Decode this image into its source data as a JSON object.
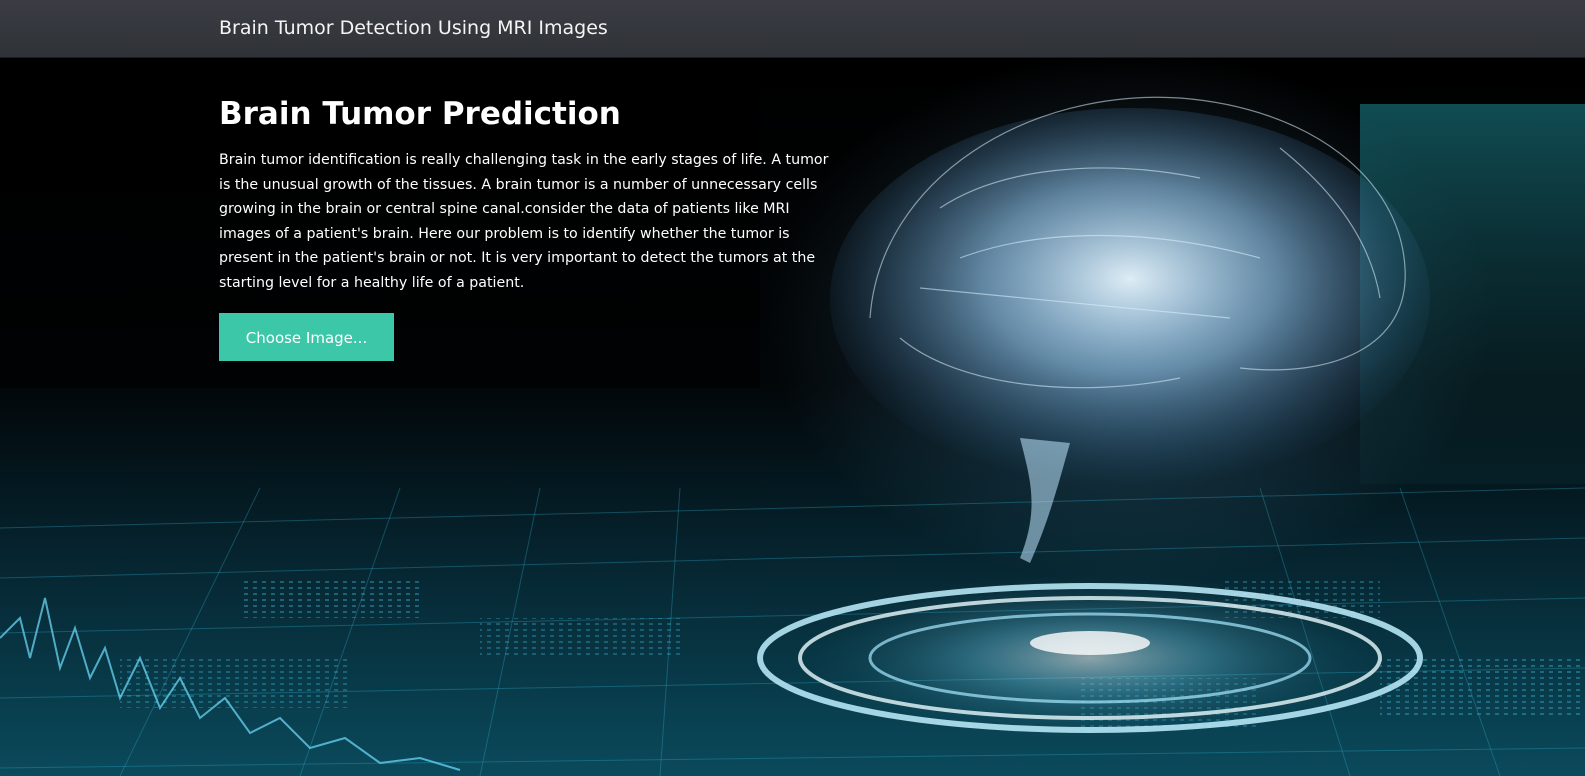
{
  "navbar": {
    "brand": "Brain Tumor Detection Using MRI Images"
  },
  "hero": {
    "title": "Brain Tumor Prediction",
    "description": "Brain tumor identification is really challenging task in the early stages of life. A tumor is the unusual growth of the tissues. A brain tumor is a number of unnecessary cells growing in the brain or central spine canal.consider the data of patients like MRI images of a patient's brain. Here our problem is to identify whether the tumor is present in the patient's brain or not. It is very important to detect the tumors at the starting level for a healthy life of a patient.",
    "choose_button_label": "Choose Image..."
  },
  "colors": {
    "navbar_bg": "#35383d",
    "button_bg": "#3cc8a8",
    "text": "#ffffff",
    "glow": "#7fd8ff"
  }
}
